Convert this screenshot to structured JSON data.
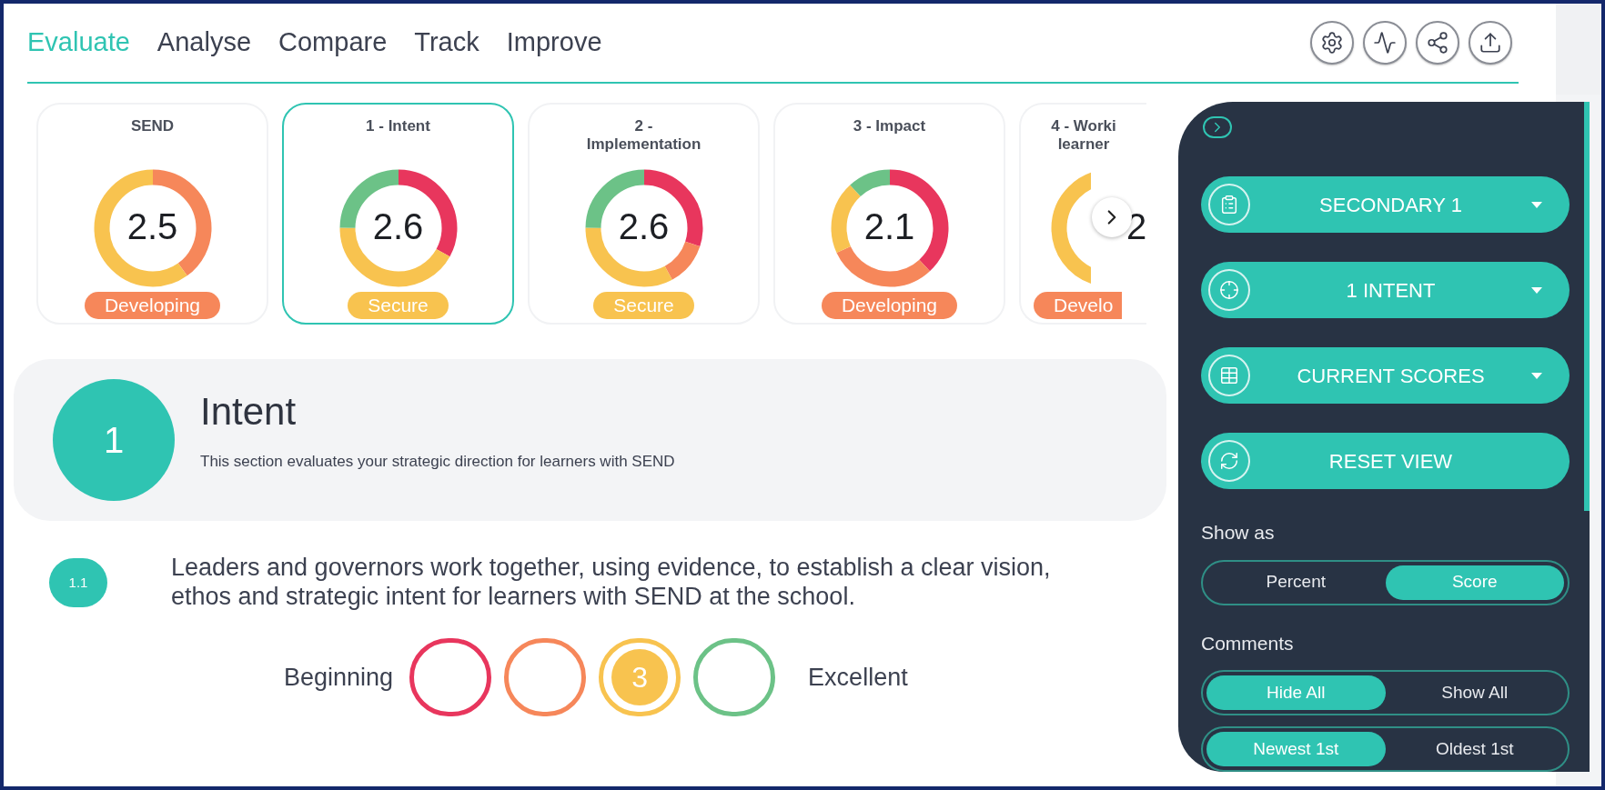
{
  "nav": {
    "tabs": [
      {
        "label": "Evaluate",
        "selected": true
      },
      {
        "label": "Analyse",
        "selected": false
      },
      {
        "label": "Compare",
        "selected": false
      },
      {
        "label": "Track",
        "selected": false
      },
      {
        "label": "Improve",
        "selected": false
      }
    ],
    "actions": [
      {
        "kind": "settings"
      },
      {
        "kind": "activity"
      },
      {
        "kind": "share"
      },
      {
        "kind": "upload"
      }
    ]
  },
  "cards": [
    {
      "title_lines": [
        "SEND"
      ],
      "score": "2.5",
      "badge": "Developing",
      "kind": "developing",
      "selected": false
    },
    {
      "title_lines": [
        "1 - Intent"
      ],
      "score": "2.6",
      "badge": "Secure",
      "kind": "secure",
      "selected": true
    },
    {
      "title_lines": [
        "2 -",
        "Implementation"
      ],
      "score": "2.6",
      "badge": "Secure",
      "kind": "secure",
      "selected": false
    },
    {
      "title_lines": [
        "3 - Impact"
      ],
      "score": "2.1",
      "badge": "Developing",
      "kind": "developing",
      "selected": false
    },
    {
      "title_lines": [
        "4 - Worki",
        "learner"
      ],
      "score": "2",
      "badge": "Develo",
      "kind": "developing",
      "selected": false
    }
  ],
  "section": {
    "number": "1",
    "title": "Intent",
    "description": "This section evaluates your strategic direction for learners with SEND"
  },
  "question": {
    "number": "1.1",
    "text": "Leaders and governors work together, using evidence, to establish a clear vision, ethos and strategic intent for learners with SEND at the school."
  },
  "rating": {
    "low_label": "Beginning",
    "high_label": "Excellent",
    "options": [
      {
        "color": "#e8365d",
        "selected": false
      },
      {
        "color": "#f6875a",
        "selected": false
      },
      {
        "color": "#f8c34f",
        "selected": true,
        "label": "3"
      },
      {
        "color": "#6cc287",
        "selected": false
      }
    ]
  },
  "panel": {
    "expanded": true,
    "dropdowns": [
      {
        "kind": "clipboard",
        "label": "SECONDARY 1"
      },
      {
        "kind": "target",
        "label": "1 INTENT"
      },
      {
        "kind": "table",
        "label": "CURRENT SCORES"
      },
      {
        "kind": "reset",
        "label": "RESET VIEW"
      }
    ],
    "show_as": {
      "label": "Show as",
      "options": [
        {
          "label": "Percent",
          "selected": false
        },
        {
          "label": "Score",
          "selected": true
        }
      ]
    },
    "comments": {
      "label": "Comments",
      "options": [
        {
          "label": "Hide All",
          "selected": true
        },
        {
          "label": "Show All",
          "selected": false
        }
      ]
    },
    "sort": {
      "options": [
        {
          "label": "Newest 1st",
          "selected": true
        },
        {
          "label": "Oldest 1st",
          "selected": false
        }
      ]
    }
  }
}
